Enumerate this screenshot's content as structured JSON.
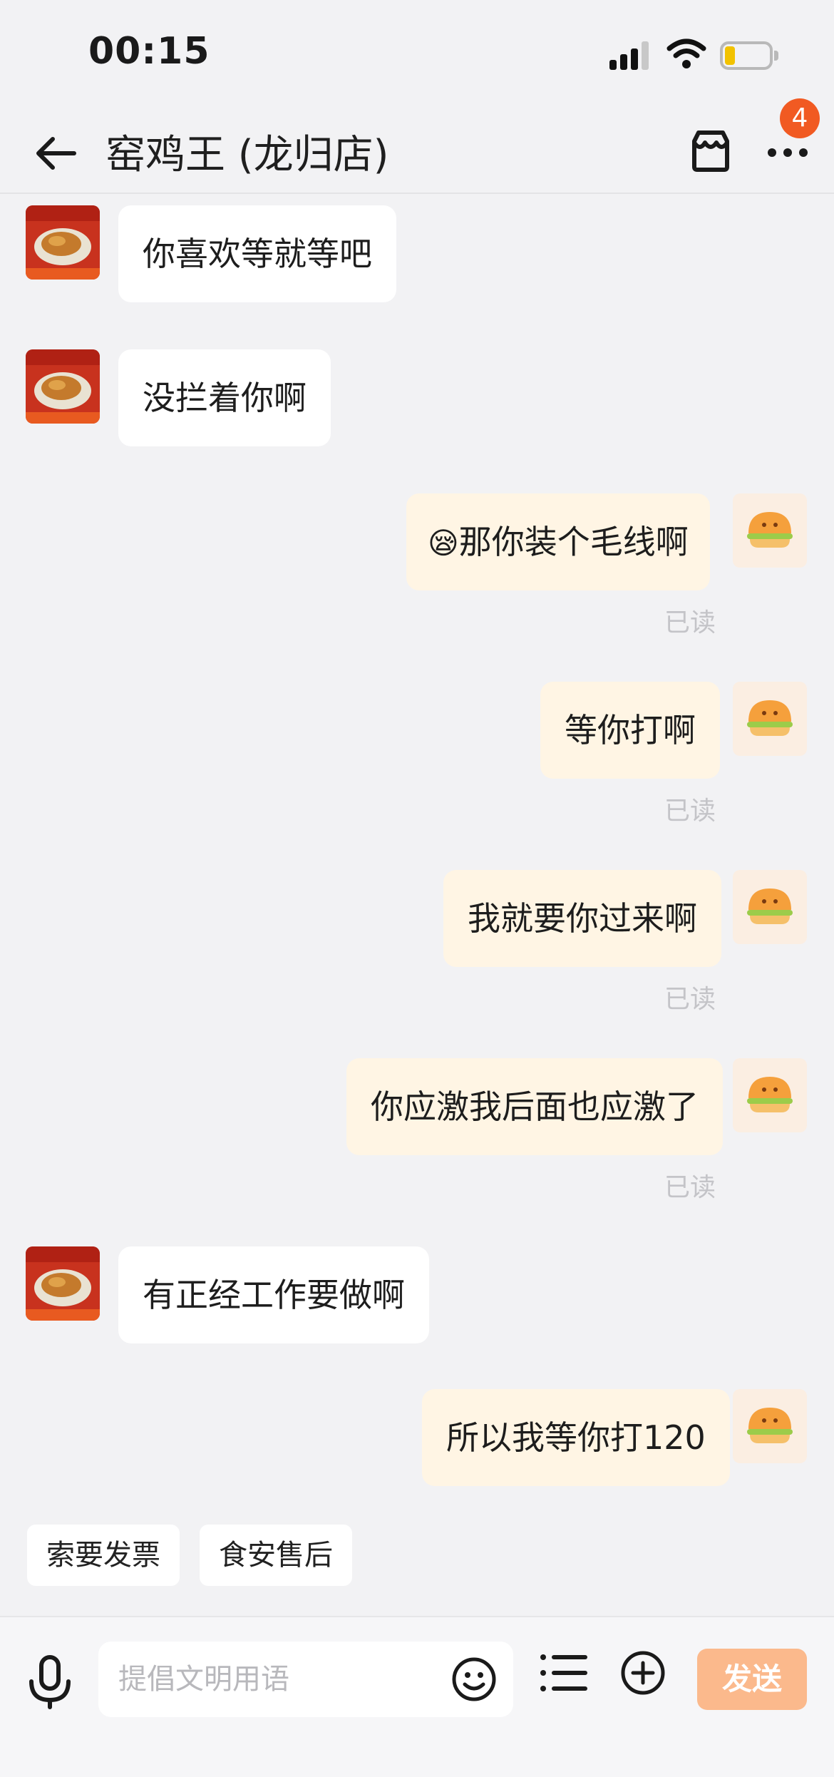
{
  "status_bar": {
    "time": "00:15"
  },
  "header": {
    "title": "窑鸡王 (龙归店)",
    "badge_count": "4"
  },
  "messages": [
    {
      "side": "in",
      "text": "你喜欢等就等吧"
    },
    {
      "side": "in",
      "text": "没拦着你啊"
    },
    {
      "side": "out",
      "emoji": "😪",
      "text": "那你装个毛线啊",
      "status": "已读"
    },
    {
      "side": "out",
      "text": "等你打啊",
      "status": "已读"
    },
    {
      "side": "out",
      "text": "我就要你过来啊",
      "status": "已读"
    },
    {
      "side": "out",
      "text": "你应激我后面也应激了",
      "status": "已读"
    },
    {
      "side": "in",
      "text": "有正经工作要做啊"
    },
    {
      "side": "out",
      "text": "所以我等你打120"
    }
  ],
  "quick_replies": [
    "索要发票",
    "食安售后"
  ],
  "input": {
    "placeholder": "提倡文明用语",
    "send_label": "发送"
  },
  "colors": {
    "accent": "#f15a22",
    "send_button": "#fbb98c",
    "outgoing_bubble": "#fff5e4",
    "background": "#f2f2f4"
  }
}
